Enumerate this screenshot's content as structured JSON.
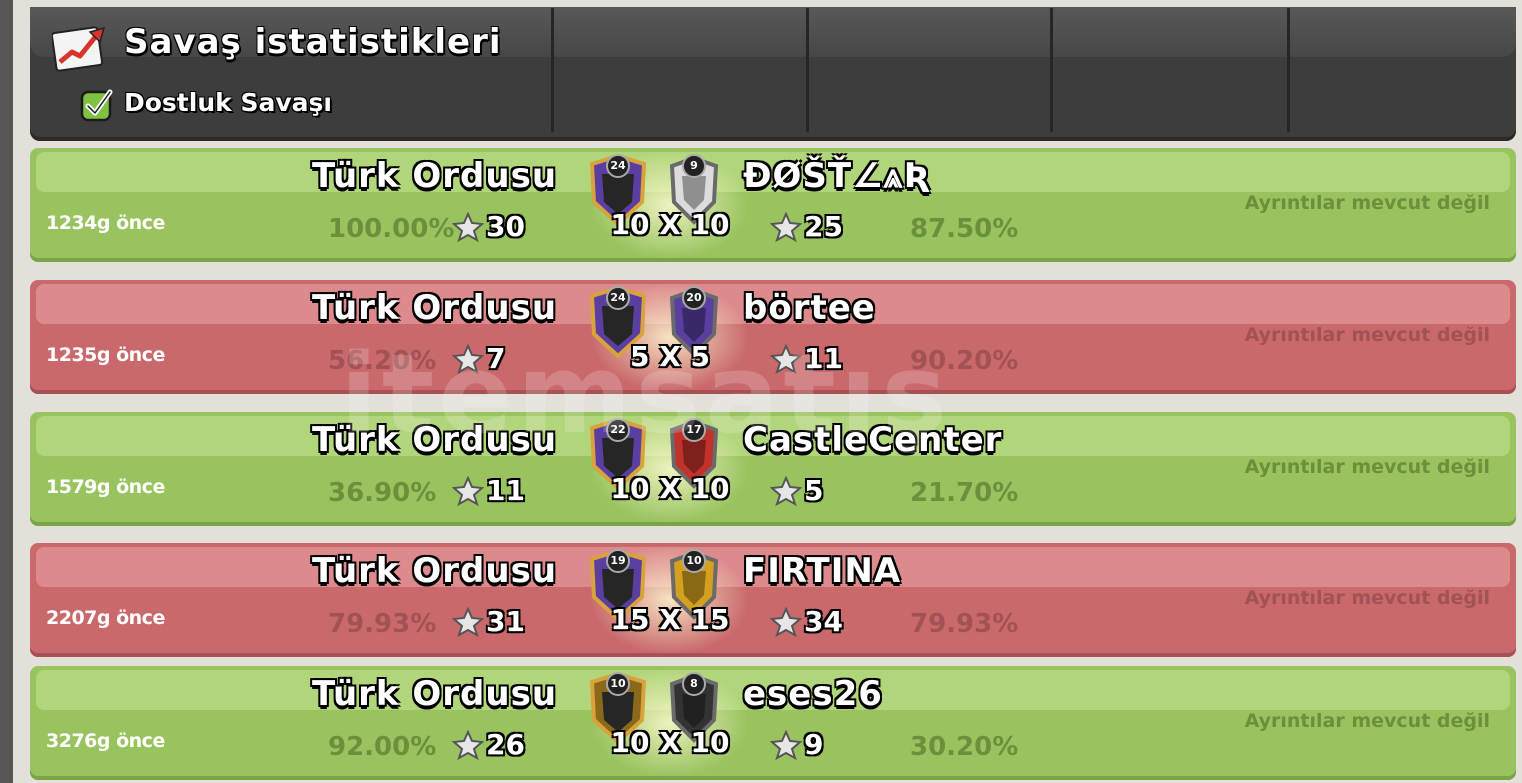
{
  "header": {
    "title": "Savaş istatistikleri",
    "filter_label": "Dostluk Savaşı",
    "filter_checked": true,
    "title_icon": "chart-up-icon",
    "filter_icon": "checkbox-icon"
  },
  "colors": {
    "win": "#98c35e",
    "loss": "#c9696c",
    "header": "#3d3d3d"
  },
  "watermark": "itemsatış",
  "wars": [
    {
      "result": "win",
      "ago": "1234g önce",
      "our_clan": "Türk Ordusu",
      "our_level": "24",
      "our_percent": "100.00%",
      "our_stars": "30",
      "size": "10 X 10",
      "opp_clan": "ĐØŠŤ∠⩓Ʀ",
      "opp_level": "9",
      "opp_stars": "25",
      "opp_percent": "87.50%",
      "details": "Ayrıntılar mevcut değil"
    },
    {
      "result": "loss",
      "ago": "1235g önce",
      "our_clan": "Türk Ordusu",
      "our_level": "24",
      "our_percent": "56.20%",
      "our_stars": "7",
      "size": "5 X 5",
      "opp_clan": "börtee",
      "opp_level": "20",
      "opp_stars": "11",
      "opp_percent": "90.20%",
      "details": "Ayrıntılar mevcut değil"
    },
    {
      "result": "win",
      "ago": "1579g önce",
      "our_clan": "Türk Ordusu",
      "our_level": "22",
      "our_percent": "36.90%",
      "our_stars": "11",
      "size": "10 X 10",
      "opp_clan": "CastleCenter",
      "opp_level": "17",
      "opp_stars": "5",
      "opp_percent": "21.70%",
      "details": "Ayrıntılar mevcut değil"
    },
    {
      "result": "loss",
      "ago": "2207g önce",
      "our_clan": "Türk Ordusu",
      "our_level": "19",
      "our_percent": "79.93%",
      "our_stars": "31",
      "size": "15 X 15",
      "opp_clan": "FIRTINA",
      "opp_level": "10",
      "opp_stars": "34",
      "opp_percent": "79.93%",
      "details": "Ayrıntılar mevcut değil"
    },
    {
      "result": "win",
      "ago": "3276g önce",
      "our_clan": "Türk Ordusu",
      "our_level": "10",
      "our_percent": "92.00%",
      "our_stars": "26",
      "size": "10 X 10",
      "opp_clan": "eses26",
      "opp_level": "8",
      "opp_stars": "9",
      "opp_percent": "30.20%",
      "details": "Ayrıntılar mevcut değil"
    }
  ]
}
